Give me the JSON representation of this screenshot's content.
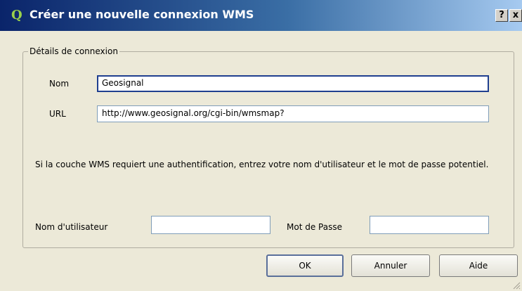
{
  "window": {
    "title": "Créer une nouvelle connexion WMS",
    "app_icon": "qgis-icon",
    "help_label": "?",
    "close_label": "✕"
  },
  "group": {
    "title": "Détails de connexion"
  },
  "fields": {
    "name_label": "Nom",
    "name_value": "Geosignal",
    "url_label": "URL",
    "url_value": "http://www.geosignal.org/cgi-bin/wmsmap?",
    "info_text": "Si la couche WMS requiert une authentification, entrez votre nom d'utilisateur et le mot de passe potentiel.",
    "username_label": "Nom d'utilisateur",
    "username_value": "",
    "password_label": "Mot de Passe",
    "password_value": ""
  },
  "buttons": {
    "ok": "OK",
    "cancel": "Annuler",
    "help": "Aide"
  }
}
